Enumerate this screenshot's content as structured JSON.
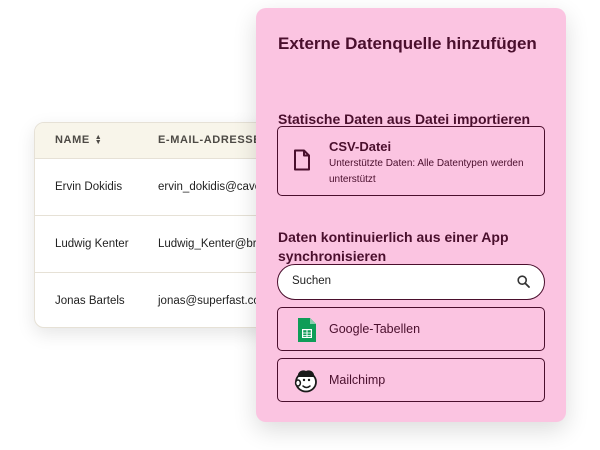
{
  "table": {
    "columns": [
      "NAME",
      "E-MAIL-ADRESSE"
    ],
    "rows": [
      {
        "name": "Ervin Dokidis",
        "email": "ervin_dokidis@cave"
      },
      {
        "name": "Ludwig Kenter",
        "email": "Ludwig_Kenter@bri"
      },
      {
        "name": "Jonas Bartels",
        "email": "jonas@superfast.con"
      }
    ]
  },
  "panel": {
    "title": "Externe Datenquelle hinzufügen",
    "static_section": {
      "heading": "Statische Daten aus Datei importieren",
      "csv": {
        "title": "CSV-Datei",
        "description": "Unterstützte Daten: Alle Datentypen werden unterstützt",
        "icon": "file-icon"
      }
    },
    "sync_section": {
      "heading": "Daten kontinuierlich aus einer App synchronisieren",
      "search": {
        "text": "Suchen",
        "icon": "search-icon"
      },
      "apps": [
        {
          "label": "Google-Tabellen",
          "icon": "google-sheets-icon"
        },
        {
          "label": "Mailchimp",
          "icon": "mailchimp-icon"
        }
      ]
    }
  },
  "colors": {
    "panel_background": "#fbc4e1",
    "panel_text": "#4a0f2d",
    "table_header_background": "#f8f5ea",
    "google_sheets_green": "#0f9d58"
  }
}
